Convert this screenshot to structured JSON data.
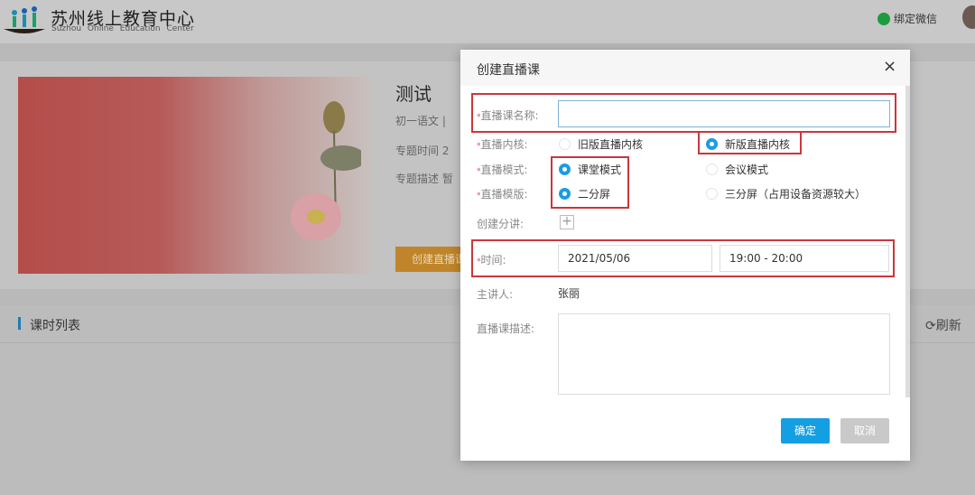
{
  "header": {
    "brand": "苏州线上教育中心",
    "brand_en": "Suzhou Online Education Center",
    "wechat": "绑定微信"
  },
  "course": {
    "title": "测试",
    "lines": [
      "初一语文 | ",
      "专题时间 2",
      "专题描述 暂"
    ],
    "create_button": "创建直播课"
  },
  "lesson_list": {
    "title": "课时列表",
    "refresh": "刷新"
  },
  "modal": {
    "title": "创建直播课",
    "close": "×",
    "name_label": "直播课名称:",
    "name_value": "",
    "kernel_label": "直播内核:",
    "kernel_options": [
      "旧版直播内核",
      "新版直播内核"
    ],
    "kernel_selected": 1,
    "mode_label": "直播模式:",
    "mode_options": [
      "课堂模式",
      "会议模式"
    ],
    "mode_selected": 0,
    "template_label": "直播模版:",
    "template_options": [
      "二分屏",
      "三分屏（占用设备资源较大）"
    ],
    "template_selected": 0,
    "sub_label": "创建分讲:",
    "sub_add": "+",
    "time_label": "时间:",
    "date": "2021/05/06",
    "time_range": "19:00 - 20:00",
    "speaker_label": "主讲人:",
    "speaker": "张丽",
    "desc_label": "直播课描述:",
    "desc_value": "",
    "ok": "确定",
    "cancel": "取消"
  },
  "colors": {
    "accent": "#159fe3",
    "highlight": "#c9373d",
    "required": "#d9534f"
  }
}
